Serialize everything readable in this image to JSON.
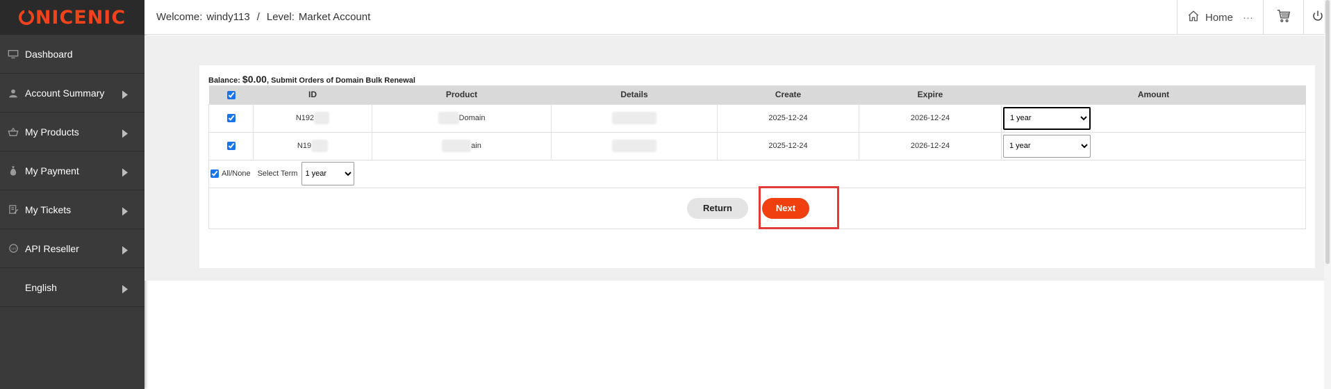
{
  "brand": {
    "logo_text": "NICENIC",
    "color": "#f0431c"
  },
  "header": {
    "welcome_label": "Welcome:",
    "username": "windy113",
    "separator": "/",
    "level_label": "Level:",
    "level_value": "Market Account",
    "home_label": "Home",
    "more_label": "···"
  },
  "sidebar": {
    "items": [
      {
        "label": "Dashboard",
        "icon": "monitor-icon",
        "has_arrow": false
      },
      {
        "label": "Account Summary",
        "icon": "user-icon",
        "has_arrow": true
      },
      {
        "label": "My Products",
        "icon": "basket-icon",
        "has_arrow": true
      },
      {
        "label": "My Payment",
        "icon": "money-bag-icon",
        "has_arrow": true
      },
      {
        "label": "My Tickets",
        "icon": "ticket-edit-icon",
        "has_arrow": true
      },
      {
        "label": "API Reseller",
        "icon": "api-icon",
        "has_arrow": true
      },
      {
        "label": "English",
        "icon": "",
        "has_arrow": true
      }
    ]
  },
  "panel": {
    "balance_label": "Balance:",
    "balance_amount": "$0.00",
    "balance_suffix": ", Submit Orders of Domain Bulk Renewal"
  },
  "table": {
    "headers": {
      "id": "ID",
      "product": "Product",
      "details": "Details",
      "create": "Create",
      "expire": "Expire",
      "amount": "Amount"
    },
    "rows": [
      {
        "checked": true,
        "id": "N192",
        "product": "Domain",
        "create": "2025-12-24",
        "expire": "2026-12-24",
        "amount": "1 year"
      },
      {
        "checked": true,
        "id": "N19",
        "product": "ain",
        "create": "2025-12-24",
        "expire": "2026-12-24",
        "amount": "1 year"
      }
    ]
  },
  "controls": {
    "all_none_label": "All/None",
    "select_term_label": "Select Term",
    "term_value": "1 year"
  },
  "buttons": {
    "return_label": "Return",
    "next_label": "Next"
  },
  "colors": {
    "accent": "#f0400f",
    "highlight": "#e03a3a",
    "sidebar_bg": "#3a3a3a"
  }
}
